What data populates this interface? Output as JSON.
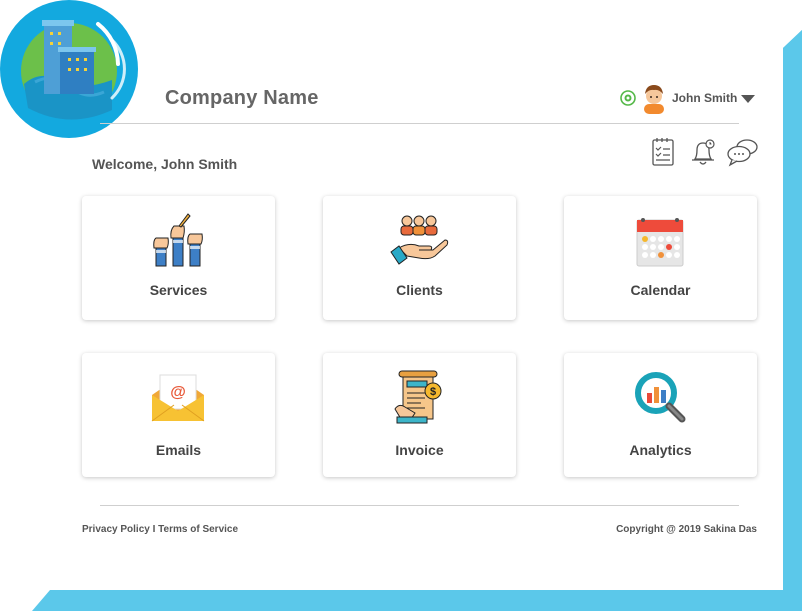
{
  "header": {
    "company_name": "Company Name",
    "user_name": "John Smith"
  },
  "welcome_text": "Welcome, John Smith",
  "tiles": [
    {
      "label": "Services",
      "icon": "hands-raised-icon"
    },
    {
      "label": "Clients",
      "icon": "people-hand-icon"
    },
    {
      "label": "Calendar",
      "icon": "calendar-icon"
    },
    {
      "label": "Emails",
      "icon": "envelope-icon"
    },
    {
      "label": "Invoice",
      "icon": "invoice-icon"
    },
    {
      "label": "Analytics",
      "icon": "magnifier-chart-icon"
    }
  ],
  "footer": {
    "privacy": "Privacy Policy",
    "separator": "I",
    "terms": "Terms of Service",
    "copyright": "Copyright @ 2019 Sakina Das"
  },
  "colors": {
    "accent_blue": "#5bc8ea",
    "logo_blue": "#13a9df",
    "logo_green": "#6cc04a"
  }
}
